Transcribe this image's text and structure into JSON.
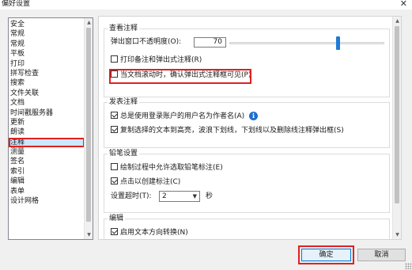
{
  "window": {
    "title": "偏好设置",
    "close_glyph": "✕"
  },
  "categories": {
    "items": [
      "安全",
      "常规",
      "常规",
      "平板",
      "打印",
      "拼写检查",
      "搜索",
      "文件关联",
      "文档",
      "时间戳服务器",
      "更新",
      "朗读",
      "注释",
      "测量",
      "签名",
      "索引",
      "编辑",
      "表单",
      "设计网格"
    ],
    "selected": "注释"
  },
  "view_group": {
    "title": "查看注释",
    "opacity_label": "弹出窗口不透明度(O):",
    "opacity_value": "70",
    "opacity_fraction": 0.7,
    "print_popups": "打印备注和弹出式注释(R)",
    "confirm_visible": "当文档滚动时，确认弹出式注释框可见(P)",
    "print_popups_checked": false,
    "confirm_visible_checked": false
  },
  "publish_group": {
    "title": "发表注释",
    "use_login_name": "总是使用登录账户的用户名为作者名(A)",
    "copy_selected": "复制选择的文本到高亮，波浪下划线，下划线以及删除线注释弹出框(S)",
    "use_login_name_checked": true,
    "copy_selected_checked": true,
    "info_glyph": "i"
  },
  "pencil_group": {
    "title": "铅笔设置",
    "allow_select": "绘制过程中允许选取铅笔标注(E)",
    "click_create": "点击以创建标注(C)",
    "allow_select_checked": false,
    "click_create_checked": true,
    "timeout_label": "设置超时(T):",
    "timeout_value": "2",
    "timeout_unit": "秒"
  },
  "edit_group": {
    "title": "编辑",
    "text_direction": "启用文本方向转换(N)",
    "text_direction_checked": true
  },
  "buttons": {
    "ok": "确定",
    "cancel": "取消"
  },
  "accent": "#1e7bd6",
  "highlight": "#e02020"
}
